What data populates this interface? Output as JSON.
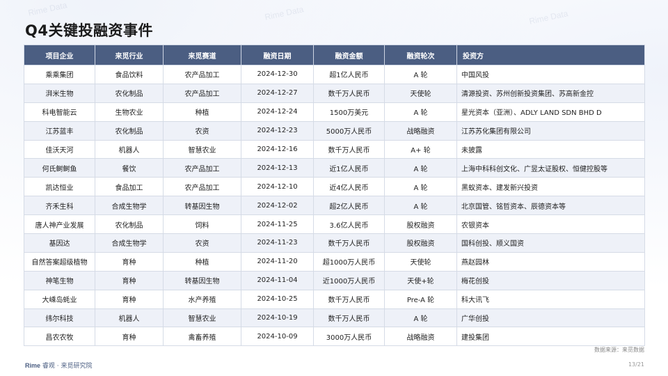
{
  "title": "Q4关键投融资事件",
  "table": {
    "headers": [
      "项目企业",
      "来觅行业",
      "来觅赛道",
      "融资日期",
      "融资金额",
      "融资轮次",
      "投资方"
    ],
    "rows": [
      [
        "乘乘集团",
        "食品饮料",
        "农产品加工",
        "2024-12-30",
        "超1亿人民币",
        "A 轮",
        "中国风投"
      ],
      [
        "湃米生物",
        "农化制品",
        "农产品加工",
        "2024-12-27",
        "数千万人民币",
        "天使轮",
        "清源投资、苏州创新投资集团、苏高新金控"
      ],
      [
        "科电智能云",
        "生物农业",
        "种植",
        "2024-12-24",
        "1500万美元",
        "A 轮",
        "星光资本（亚洲）、ADLY LAND SDN BHD D"
      ],
      [
        "江苏蓝丰",
        "农化制品",
        "农资",
        "2024-12-23",
        "5000万人民币",
        "战略融资",
        "江苏苏化集团有限公司"
      ],
      [
        "佳沃天河",
        "机器人",
        "智慧农业",
        "2024-12-16",
        "数千万人民币",
        "A+ 轮",
        "未披露"
      ],
      [
        "何氏鲥鲥鱼",
        "餐饮",
        "农产品加工",
        "2024-12-13",
        "近1亿人民币",
        "A 轮",
        "上海中科科创文化、广昱太证股权、恒健控股等"
      ],
      [
        "凯达恒业",
        "食品加工",
        "农产品加工",
        "2024-12-10",
        "近4亿人民币",
        "A 轮",
        "黑蚁资本、建发新兴投资"
      ],
      [
        "齐禾生科",
        "合成生物学",
        "转基因生物",
        "2024-12-02",
        "超2亿人民币",
        "A 轮",
        "北京国管、铭哲资本、辰德资本等"
      ],
      [
        "唐人神产业发展",
        "农化制品",
        "饲料",
        "2024-11-25",
        "3.6亿人民币",
        "股权融资",
        "农银资本"
      ],
      [
        "基因达",
        "合成生物学",
        "农资",
        "2024-11-23",
        "数千万人民币",
        "股权融资",
        "国科创投、顺义国资"
      ],
      [
        "自然答案超级植物",
        "育种",
        "种植",
        "2024-11-20",
        "超1000万人民币",
        "天使轮",
        "燕赵园林"
      ],
      [
        "神笔生物",
        "育种",
        "转基因生物",
        "2024-11-04",
        "近1000万人民币",
        "天使+轮",
        "梅花创投"
      ],
      [
        "大嵊岛蚝业",
        "育种",
        "水产养殖",
        "2024-10-25",
        "数千万人民币",
        "Pre-A 轮",
        "科大讯飞"
      ],
      [
        "纬尔科技",
        "机器人",
        "智慧农业",
        "2024-10-19",
        "数千万人民币",
        "A 轮",
        "广华创投"
      ],
      [
        "昌农农牧",
        "育种",
        "禽畜养殖",
        "2024-10-09",
        "3000万人民币",
        "战略融资",
        "建投集团"
      ]
    ]
  },
  "footer": {
    "source": "数据来源：来觅数据",
    "brand": "Rime",
    "org": "睿观 · 来觅研究院",
    "page": "13/21"
  },
  "watermark_text": "Rime Data"
}
